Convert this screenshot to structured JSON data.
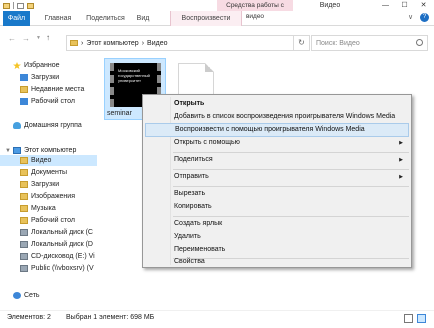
{
  "window": {
    "title": "Видео",
    "context_tab_title": "Средства работы с видео",
    "controls": [
      "—",
      "☐",
      "✕"
    ]
  },
  "ribbon": {
    "tabs": [
      "Файл",
      "Главная",
      "Поделиться",
      "Вид",
      "Воспроизвести"
    ],
    "active_context_tab": "Воспроизвести",
    "toggle": "∨",
    "help": "?"
  },
  "address": {
    "separator": "›",
    "path": [
      "Этот компьютер",
      "Видео"
    ],
    "search_placeholder": "Поиск: Видео"
  },
  "nav_pane": {
    "favorites": {
      "label": "Избранное",
      "items": [
        "Загрузки",
        "Недавние места",
        "Рабочий стол"
      ]
    },
    "homegroup": "Домашняя группа",
    "this_pc": {
      "label": "Этот компьютер",
      "items": [
        "Видео",
        "Документы",
        "Загрузки",
        "Изображения",
        "Музыка",
        "Рабочий стол",
        "Локальный диск (C",
        "Локальный диск (D",
        "CD-дисковод (E:) Vi",
        "Public (\\\\vboxsrv) (V"
      ],
      "selected": "Видео"
    },
    "network": "Сеть"
  },
  "files": [
    {
      "name": "seminar",
      "thumbnail_text": "Московский государственный университет",
      "selected": true
    },
    {
      "name": "",
      "selected": false
    }
  ],
  "context_menu": {
    "items": [
      {
        "label": "Открыть",
        "bold": true
      },
      {
        "label": "Добавить в список воспроизведения проигрывателя Windows Media"
      },
      {
        "label": "Воспроизвести с помощью проигрывателя Windows Media",
        "highlighted": true
      },
      {
        "label": "Открыть с помощью",
        "submenu": true
      },
      {
        "label": "Поделиться",
        "submenu": true
      },
      {
        "label": "Отправить",
        "submenu": true
      },
      {
        "label": "Вырезать"
      },
      {
        "label": "Копировать"
      },
      {
        "label": "Создать ярлык"
      },
      {
        "label": "Удалить"
      },
      {
        "label": "Переименовать"
      },
      {
        "label": "Свойства"
      }
    ],
    "submenu_arrow": "▶"
  },
  "status": {
    "items": "Элементов: 2",
    "selected": "Выбран 1 элемент: 698 МБ"
  },
  "colors": {
    "file_tab": "#1979ca",
    "context_tab": "#f7dbe3",
    "selection": "#cde8ff",
    "menu_highlight": "#dbeaf7"
  }
}
